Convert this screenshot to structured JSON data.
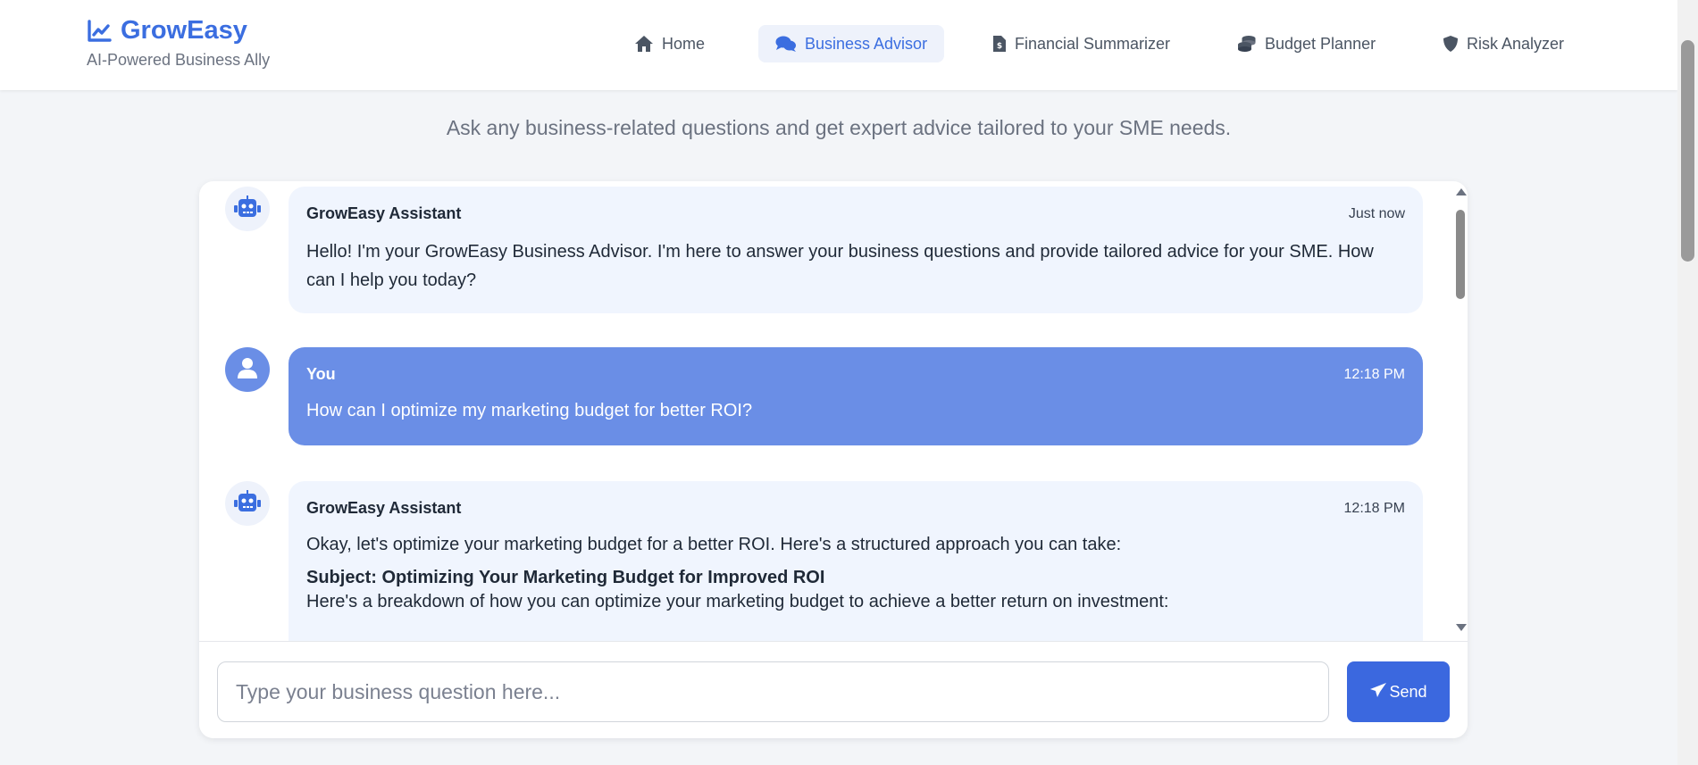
{
  "brand": {
    "title": "GrowEasy",
    "subtitle": "AI-Powered Business Ally",
    "icon": "line-chart-icon",
    "color": "#3b6ee0"
  },
  "nav": {
    "items": [
      {
        "label": "Home",
        "icon": "home-icon",
        "active": false
      },
      {
        "label": "Business Advisor",
        "icon": "comments-icon",
        "active": true
      },
      {
        "label": "Financial Summarizer",
        "icon": "file-invoice-icon",
        "active": false
      },
      {
        "label": "Budget Planner",
        "icon": "coins-icon",
        "active": false
      },
      {
        "label": "Risk Analyzer",
        "icon": "shield-icon",
        "active": false
      }
    ]
  },
  "page": {
    "subtitle": "Ask any business-related questions and get expert advice tailored to your SME needs."
  },
  "messages": [
    {
      "sender": "GrowEasy Assistant",
      "time": "Just now",
      "role": "bot",
      "text": "Hello! I'm your GrowEasy Business Advisor. I'm here to answer your business questions and provide tailored advice for your SME. How can I help you today?"
    },
    {
      "sender": "You",
      "time": "12:18 PM",
      "role": "user",
      "text": "How can I optimize my marketing budget for better ROI?"
    },
    {
      "sender": "GrowEasy Assistant",
      "time": "12:18 PM",
      "role": "bot",
      "text": "Okay, let's optimize your marketing budget for a better ROI. Here's a structured approach you can take:",
      "heading": "Subject: Optimizing Your Marketing Budget for Improved ROI",
      "text2": "Here's a breakdown of how you can optimize your marketing budget to achieve a better return on investment:"
    }
  ],
  "composer": {
    "placeholder": "Type your business question here...",
    "send_label": "Send",
    "send_icon": "paper-plane-icon"
  },
  "colors": {
    "accent": "#3b68df",
    "user_bubble": "#6a8ee6",
    "bot_bubble": "#f0f5fe",
    "background": "#f3f5f8"
  }
}
